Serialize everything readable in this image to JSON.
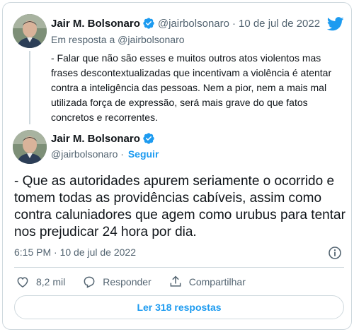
{
  "colors": {
    "accent": "#1d9bf0",
    "secondary_text": "#536471",
    "primary_text": "#0f1419",
    "border": "#cfd9de"
  },
  "parent_tweet": {
    "author_name": "Jair M. Bolsonaro",
    "handle": "@jairbolsonaro",
    "separator": "·",
    "date": "10 de jul de 2022",
    "replying_prefix": "Em resposta a",
    "replying_to": "@jairbolsonaro",
    "text": "- Falar que não são esses e muitos outros atos violentos mas frases descontextualizadas que incentivam a violência é atentar contra a inteligência das pessoas. Nem a pior, nem a mais mal utilizada força de expressão, será mais grave do que fatos concretos e recorrentes.",
    "icons": [
      "verified-badge-icon",
      "twitter-bird-icon",
      "avatar"
    ]
  },
  "main_tweet": {
    "author_name": "Jair M. Bolsonaro",
    "handle": "@jairbolsonaro",
    "separator": "·",
    "follow_label": "Seguir",
    "text": "- Que as autoridades apurem seriamente o ocorrido e tomem todas as providências cabíveis, assim como contra caluniadores que agem como urubus para tentar nos prejudicar 24 hora por dia.",
    "timestamp": "6:15 PM · 10 de jul de 2022",
    "icons": [
      "verified-badge-icon",
      "info-icon",
      "avatar"
    ]
  },
  "actions": {
    "like_count": "8,2 mil",
    "reply_label": "Responder",
    "share_label": "Compartilhar",
    "icons": [
      "heart-icon",
      "reply-icon",
      "share-icon"
    ]
  },
  "read_replies_label": "Ler 318 respostas"
}
